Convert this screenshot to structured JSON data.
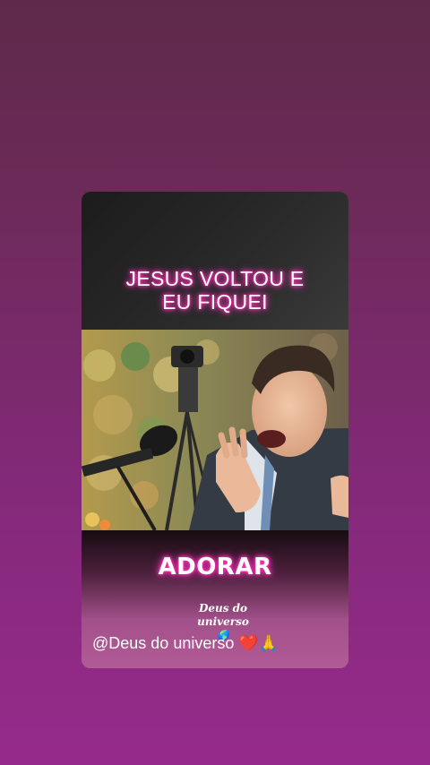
{
  "story": {
    "headline_line1": "JESUS VOLTOU E",
    "headline_line2": "EU FIQUEI",
    "caption": "ADORAR",
    "sticker_line1": "Deus do",
    "sticker_line2": "universo",
    "sticker_icon": "globe-icon",
    "mention": "@Deus do universo ❤️🙏"
  },
  "colors": {
    "background_top": "#5e2a4a",
    "background_bottom": "#962a8c",
    "text_glow": "#ff2fb2"
  }
}
